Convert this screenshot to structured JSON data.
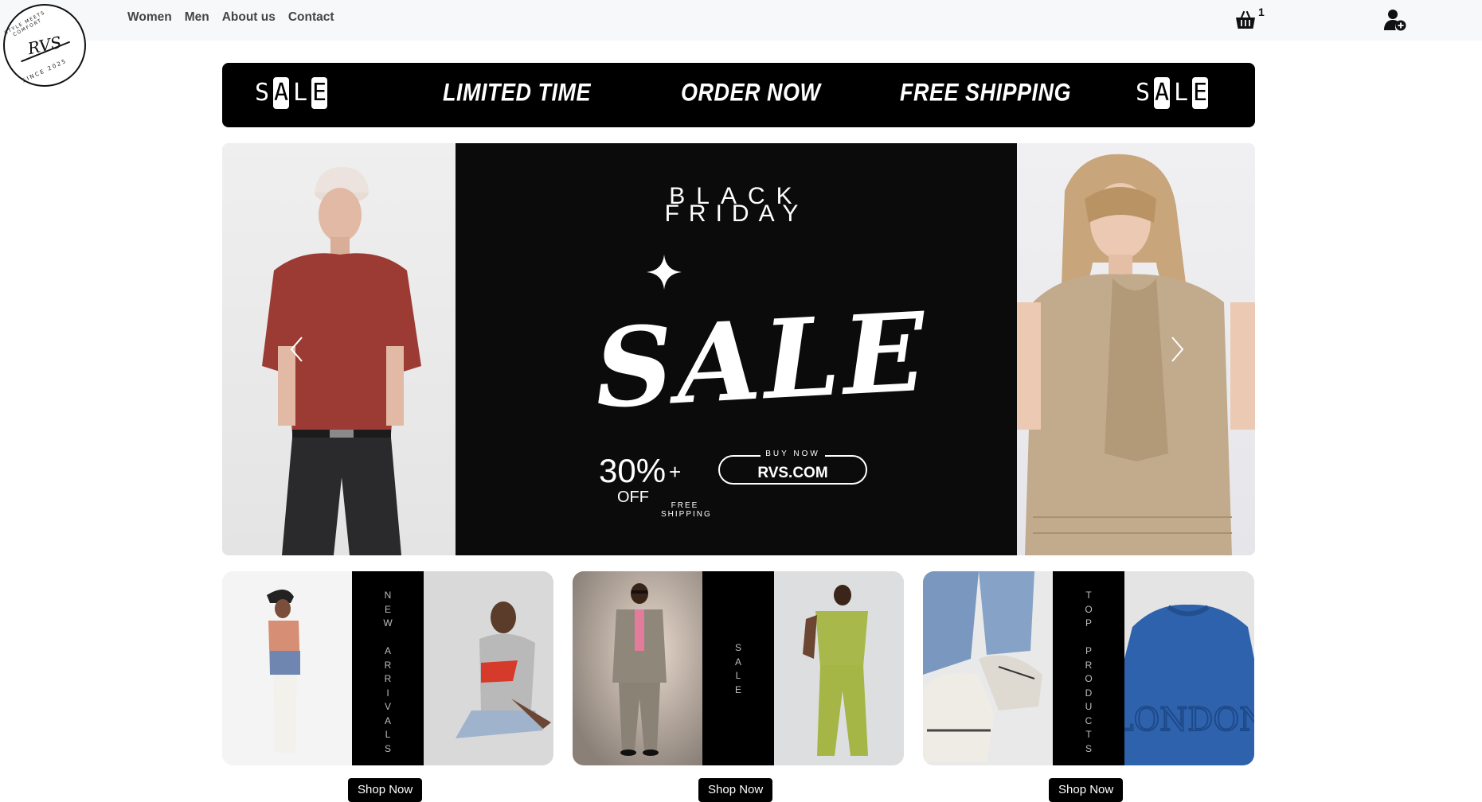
{
  "logo": {
    "ring_text": "STYLE MEETS COMFORT",
    "monogram": "RVS",
    "since_text": "SINCE 2025"
  },
  "nav": {
    "items": [
      "Women",
      "Men",
      "About us",
      "Contact"
    ]
  },
  "cart": {
    "icon": "cart-basket-icon",
    "count": "1"
  },
  "user": {
    "icon": "user-add-icon"
  },
  "promo_strip": {
    "sale_letters": [
      "S",
      "A",
      "L",
      "E"
    ],
    "items": [
      "LIMITED TIME",
      "ORDER NOW",
      "FREE SHIPPING"
    ]
  },
  "hero": {
    "banner_line1": "BLACK",
    "banner_line2": "FRIDAY",
    "banner_big": "SALE",
    "discount": "30%",
    "discount_plus": "+",
    "discount_off": "OFF",
    "free_shipping_1": "FREE",
    "free_shipping_2": "SHIPPING",
    "buy_now": "BUY NOW",
    "url": "RVS.COM",
    "prev_icon": "chevron-left-icon",
    "next_icon": "chevron-right-icon"
  },
  "cards": [
    {
      "label_letters": [
        "N",
        "E",
        "W",
        " ",
        "A",
        "R",
        "R",
        "I",
        "V",
        "A",
        "L",
        "S"
      ],
      "button": "Shop Now"
    },
    {
      "label_letters": [
        "S",
        "A",
        "L",
        "E"
      ],
      "button": "Shop Now"
    },
    {
      "label_letters": [
        "T",
        "O",
        "P",
        " ",
        "P",
        "R",
        "O",
        "D",
        "U",
        "C",
        "T",
        "S"
      ],
      "button": "Shop Now"
    }
  ]
}
